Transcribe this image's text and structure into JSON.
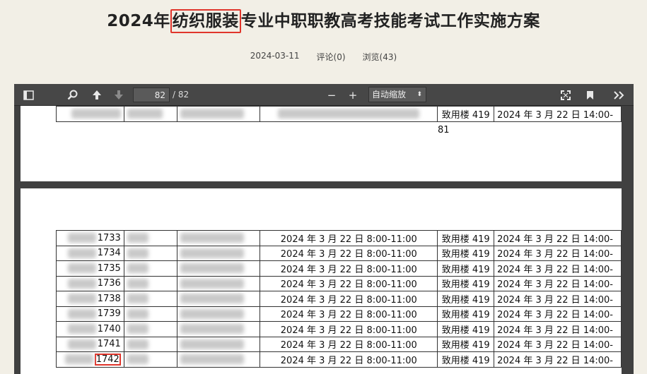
{
  "article": {
    "title_before": "2024年",
    "title_highlight": "纺织服装",
    "title_after": "专业中职职教高考技能考试工作实施方案",
    "date": "2024-03-11",
    "comments": "评论(0)",
    "views": "浏览(43)"
  },
  "toolbar": {
    "current_page": "82",
    "total_pages": "/ 82",
    "zoom_label": "自动缩放",
    "zoom_minus": "−",
    "zoom_plus": "+"
  },
  "page1": {
    "row": {
      "room": "致用楼 419",
      "practical_time": "2024 年 3 月 22 日 14:00-"
    },
    "page_number": "81"
  },
  "page2": {
    "rows": [
      {
        "id": "1733",
        "exam_time": "2024 年 3 月 22 日  8:00-11:00",
        "room": "致用楼 419",
        "practical_time": "2024 年 3 月 22 日  14:00-"
      },
      {
        "id": "1734",
        "exam_time": "2024 年 3 月 22 日  8:00-11:00",
        "room": "致用楼 419",
        "practical_time": "2024 年 3 月 22 日  14:00-"
      },
      {
        "id": "1735",
        "exam_time": "2024 年 3 月 22 日  8:00-11:00",
        "room": "致用楼 419",
        "practical_time": "2024 年 3 月 22 日  14:00-"
      },
      {
        "id": "1736",
        "exam_time": "2024 年 3 月 22 日  8:00-11:00",
        "room": "致用楼 419",
        "practical_time": "2024 年 3 月 22 日  14:00-"
      },
      {
        "id": "1738",
        "exam_time": "2024 年 3 月 22 日  8:00-11:00",
        "room": "致用楼 419",
        "practical_time": "2024 年 3 月 22 日  14:00-"
      },
      {
        "id": "1739",
        "exam_time": "2024 年 3 月 22 日  8:00-11:00",
        "room": "致用楼 419",
        "practical_time": "2024 年 3 月 22 日  14:00-"
      },
      {
        "id": "1740",
        "exam_time": "2024 年 3 月 22 日  8:00-11:00",
        "room": "致用楼 419",
        "practical_time": "2024 年 3 月 22 日  14:00-"
      },
      {
        "id": "1741",
        "exam_time": "2024 年 3 月 22 日  8:00-11:00",
        "room": "致用楼 419",
        "practical_time": "2024 年 3 月 22 日  14:00-"
      },
      {
        "id": "1742",
        "exam_time": "2024 年 3 月 22 日  8:00-11:00",
        "room": "致用楼 419",
        "practical_time": "2024 年 3 月 22 日  14:00-"
      }
    ]
  },
  "colors": {
    "highlight": "#e0352b",
    "toolbar": "#474747",
    "background": "#f2efe6"
  }
}
